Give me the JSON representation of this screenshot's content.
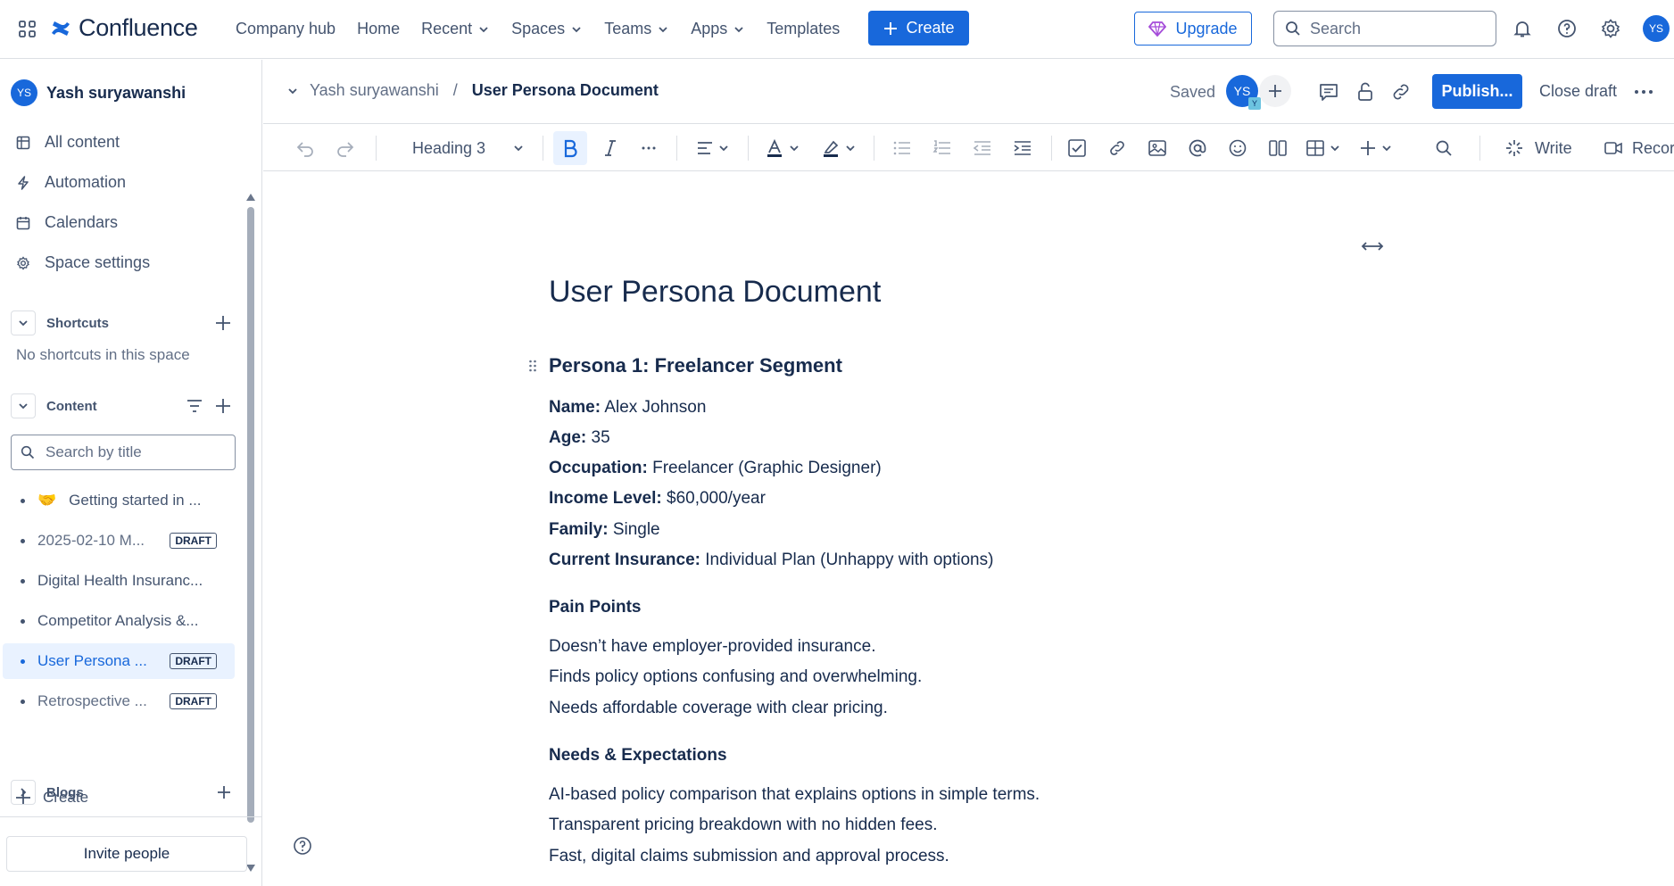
{
  "app": {
    "name": "Confluence",
    "nav": [
      "Company hub",
      "Home",
      "Recent",
      "Spaces",
      "Teams",
      "Apps",
      "Templates"
    ],
    "create_label": "Create",
    "upgrade_label": "Upgrade",
    "search_placeholder": "Search",
    "user_initials": "YS",
    "brand_color": "#1868db"
  },
  "sidebar": {
    "space_initials": "YS",
    "space_name": "Yash suryawanshi",
    "links": [
      "All content",
      "Automation",
      "Calendars",
      "Space settings"
    ],
    "shortcuts_title": "Shortcuts",
    "no_shortcuts": "No shortcuts in this space",
    "content_title": "Content",
    "search_placeholder": "Search by title",
    "tree": [
      {
        "emoji": "🤝",
        "label": "Getting started in ...",
        "draft": ""
      },
      {
        "label": "2025-02-10 M...",
        "draft": "DRAFT"
      },
      {
        "label": "Digital Health Insuranc...",
        "draft": ""
      },
      {
        "label": "Competitor Analysis &...",
        "draft": ""
      },
      {
        "label": "User Persona ...",
        "draft": "DRAFT"
      },
      {
        "label": "Retrospective ...",
        "draft": "DRAFT"
      }
    ],
    "create_label": "Create",
    "blogs_title": "Blogs",
    "invite_label": "Invite people"
  },
  "header": {
    "breadcrumb_space": "Yash suryawanshi",
    "breadcrumb_sep": "/",
    "breadcrumb_page": "User Persona Document",
    "saved": "Saved",
    "collab_initials": "YS",
    "collab_badge": "Y",
    "publish_label": "Publish...",
    "close_draft_label": "Close draft"
  },
  "toolbar": {
    "text_style": "Heading 3",
    "write_label": "Write",
    "record_label": "Recor"
  },
  "doc": {
    "title": "User Persona Document",
    "persona_heading": "Persona 1: Freelancer Segment",
    "fields": [
      {
        "key": "Name:",
        "value": "Alex Johnson"
      },
      {
        "key": "Age:",
        "value": "35"
      },
      {
        "key": "Occupation:",
        "value": "Freelancer (Graphic Designer)"
      },
      {
        "key": "Income Level:",
        "value": "$60,000/year"
      },
      {
        "key": "Family:",
        "value": "Single"
      },
      {
        "key": "Current Insurance:",
        "value": "Individual Plan (Unhappy with options)"
      }
    ],
    "pain_heading": "Pain Points",
    "pain_points": [
      "Doesn’t have employer-provided insurance.",
      "Finds policy options confusing and overwhelming.",
      "Needs affordable coverage with clear pricing."
    ],
    "needs_heading": "Needs & Expectations",
    "needs": [
      "AI-based policy comparison that explains options in simple terms.",
      "Transparent pricing breakdown with no hidden fees.",
      "Fast, digital claims submission and approval process."
    ]
  }
}
